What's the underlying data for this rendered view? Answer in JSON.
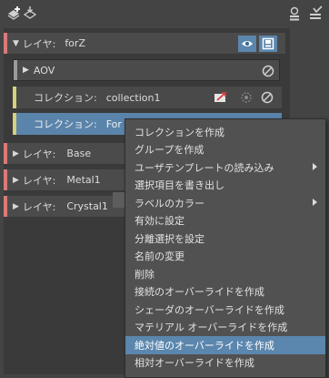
{
  "toolbar": {
    "icons": [
      "add-layer-icon",
      "import-icon",
      "render-settings-icon",
      "checklist-icon"
    ]
  },
  "layers": [
    {
      "prefix": "レイヤ:",
      "name": "forZ",
      "expanded": true
    },
    {
      "prefix": "レイヤ:",
      "name": "Base",
      "expanded": false
    },
    {
      "prefix": "レイヤ:",
      "name": "Metal1",
      "expanded": false
    },
    {
      "prefix": "レイヤ:",
      "name": "Crystal1",
      "expanded": false
    }
  ],
  "aov": {
    "label": "AOV"
  },
  "collections": [
    {
      "prefix": "コレクション:",
      "name": "collection1"
    },
    {
      "prefix": "コレクション:",
      "name": "For"
    }
  ],
  "context_menu": {
    "items": [
      {
        "label": "コレクションを作成",
        "submenu": false
      },
      {
        "label": "グループを作成",
        "submenu": false
      },
      {
        "label": "ユーザテンプレートの読み込み",
        "submenu": true
      },
      {
        "label": "選択項目を書き出し",
        "submenu": false
      },
      {
        "label": "ラベルのカラー",
        "submenu": true
      },
      {
        "label": "有効に設定",
        "submenu": false
      },
      {
        "label": "分離選択を設定",
        "submenu": false
      },
      {
        "label": "名前の変更",
        "submenu": false
      },
      {
        "label": "削除",
        "submenu": false
      },
      {
        "label": "接続のオーバーライドを作成",
        "submenu": false
      },
      {
        "label": "シェーダのオーバーライドを作成",
        "submenu": false
      },
      {
        "label": "マテリアル オーバーライドを作成",
        "submenu": false
      },
      {
        "label": "絶対値のオーバーライドを作成",
        "submenu": false,
        "active": true
      },
      {
        "label": "相対オーバーライドを作成",
        "submenu": false
      }
    ]
  },
  "colors": {
    "background": "#444444",
    "panel": "#3a3a3a",
    "layer_stripe": "#d97a7a",
    "collection_stripe": "#d7d07a",
    "aov_stripe": "#9a9a9a",
    "selection": "#5b84ab",
    "menu_background": "#515151",
    "menu_highlight": "#5b86ad",
    "visibility_active": "#5b86ad"
  }
}
